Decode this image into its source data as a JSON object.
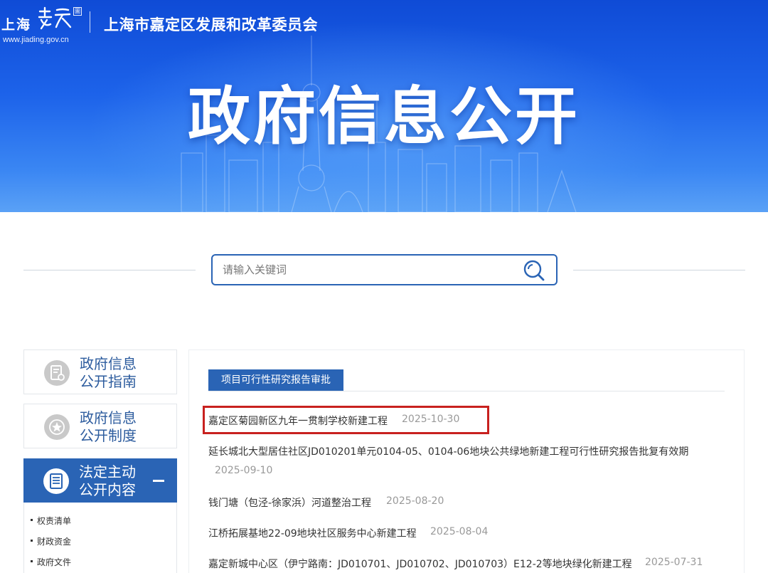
{
  "header": {
    "brand_cn": "上海",
    "brand_seal": "圖",
    "brand_url": "www.jiading.gov.cn",
    "org_title": "上海市嘉定区发展和改革委员会",
    "hero_title": "政府信息公开"
  },
  "search": {
    "placeholder": "请输入关键词",
    "icon": "search-icon"
  },
  "sidebar": {
    "items": [
      {
        "label": "政府信息\n公开指南",
        "icon": "guide-document-icon",
        "active": false
      },
      {
        "label": "政府信息\n公开制度",
        "icon": "policy-star-icon",
        "active": false
      },
      {
        "label": "法定主动\n公开内容",
        "icon": "list-document-icon",
        "active": true
      }
    ],
    "sub_items": [
      "权责清单",
      "财政资金",
      "政府文件"
    ]
  },
  "main": {
    "tab_label": "项目可行性研究报告审批",
    "list": [
      {
        "title": "嘉定区菊园新区九年一贯制学校新建工程",
        "date": "2025-10-30",
        "highlighted": true
      },
      {
        "title": "延长城北大型居住社区JD010201单元0104-05、0104-06地块公共绿地新建工程可行性研究报告批复有效期",
        "date": "2025-09-10"
      },
      {
        "title": "钱门塘（包泾-徐家浜）河道整治工程",
        "date": "2025-08-20"
      },
      {
        "title": "江桥拓展基地22-09地块社区服务中心新建工程",
        "date": "2025-08-04"
      },
      {
        "title": "嘉定新城中心区（伊宁路南：JD010701、JD010702、JD010703）E12-2等地块绿化新建工程",
        "date": "2025-07-31"
      }
    ]
  },
  "colors": {
    "primary": "#2a64b5",
    "banner_top": "#0f4bd6",
    "highlight": "#c8211f"
  }
}
